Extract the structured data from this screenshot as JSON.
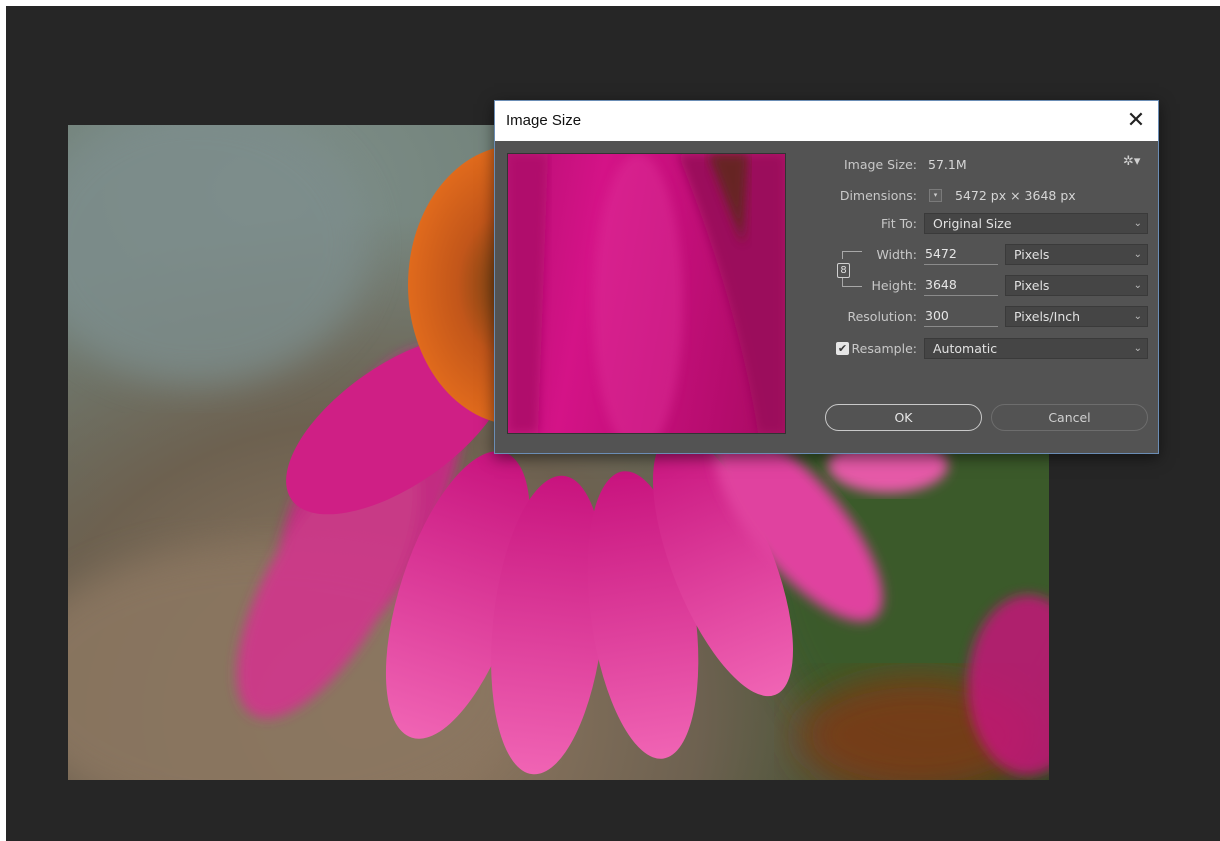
{
  "dialog": {
    "title": "Image Size",
    "close_glyph": "✕",
    "image_size_label": "Image Size:",
    "image_size_value": "57.1M",
    "dimensions_label": "Dimensions:",
    "dimensions_value": "5472 px  ×  3648 px",
    "fit_to_label": "Fit To:",
    "fit_to_value": "Original Size",
    "width_label": "Width:",
    "width_value": "5472",
    "width_unit": "Pixels",
    "height_label": "Height:",
    "height_value": "3648",
    "height_unit": "Pixels",
    "resolution_label": "Resolution:",
    "resolution_value": "300",
    "resolution_unit": "Pixels/Inch",
    "resample_label": "Resample:",
    "resample_value": "Automatic",
    "resample_checked": true,
    "ok_label": "OK",
    "cancel_label": "Cancel"
  },
  "icons": {
    "close": "close-icon",
    "gear": "gear-icon",
    "link": "link-icon",
    "chevron": "chevron-down-icon"
  },
  "colors": {
    "workspace": "#262626",
    "dialog_bg": "#535353",
    "dialog_border": "#6b8db5",
    "flower": "#d41387"
  }
}
